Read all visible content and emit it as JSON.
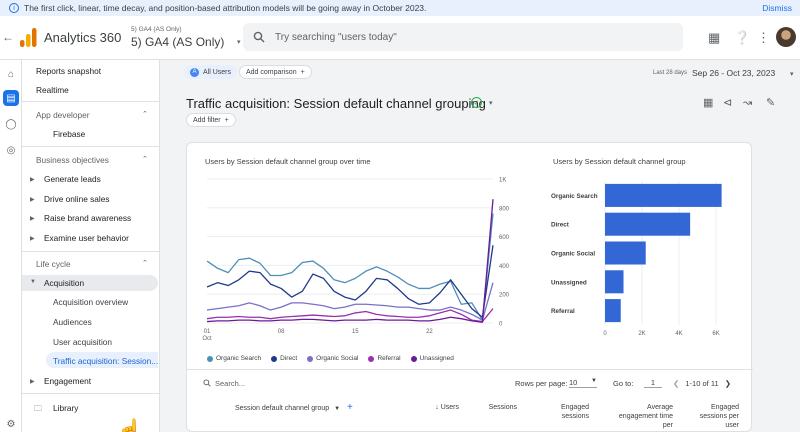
{
  "banner": {
    "message": "The first click, linear, time decay, and position-based attribution models will be going away in October 2023.",
    "dismiss": "Dismiss"
  },
  "header": {
    "app_name": "Analytics 360",
    "account_small": "5) GA4 (AS Only)",
    "account_big": "5) GA4 (AS Only)",
    "search_placeholder": "Try searching \"users today\""
  },
  "nav": {
    "reports_snapshot": "Reports snapshot",
    "realtime": "Realtime",
    "app_developer": "App developer",
    "firebase": "Firebase",
    "business_objectives": "Business objectives",
    "generate_leads": "Generate leads",
    "drive_online_sales": "Drive online sales",
    "raise_brand_awareness": "Raise brand awareness",
    "examine_user_behavior": "Examine user behavior",
    "life_cycle": "Life cycle",
    "acquisition": "Acquisition",
    "acquisition_overview": "Acquisition overview",
    "audiences": "Audiences",
    "user_acquisition": "User acquisition",
    "traffic_acquisition": "Traffic acquisition: Session...",
    "engagement": "Engagement",
    "library": "Library"
  },
  "toolbar": {
    "comparison_chip": "All Users",
    "comparison_chip_letter": "A",
    "add_comparison": "Add comparison",
    "date_label": "Last 28 days",
    "date_range": "Sep 26 - Oct 23, 2023",
    "page_title": "Traffic acquisition: Session default channel grouping",
    "add_filter": "Add filter"
  },
  "line_chart_title": "Users by Session default channel group over time",
  "bar_chart_title": "Users by Session default channel group",
  "chart_data": [
    {
      "type": "line",
      "title": "Users by Session default channel group over time",
      "x_ticks": [
        "01 Oct",
        "08",
        "15",
        "22"
      ],
      "yticks": [
        "0",
        "200",
        "400",
        "600",
        "800",
        "1K"
      ],
      "ylim": [
        0,
        1000
      ],
      "x": [
        1,
        2,
        3,
        4,
        5,
        6,
        7,
        8,
        9,
        10,
        11,
        12,
        13,
        14,
        15,
        16,
        17,
        18,
        19,
        20,
        21,
        22,
        23,
        24,
        25,
        26,
        27,
        28
      ],
      "series": [
        {
          "name": "Organic Search",
          "color": "#4e8fb8",
          "values": [
            430,
            380,
            350,
            440,
            450,
            415,
            330,
            330,
            350,
            420,
            430,
            380,
            300,
            280,
            310,
            360,
            390,
            360,
            320,
            270,
            240,
            240,
            270,
            290,
            130,
            140,
            20,
            760
          ]
        },
        {
          "name": "Direct",
          "color": "#1e3a8a",
          "values": [
            250,
            280,
            260,
            300,
            360,
            350,
            270,
            240,
            180,
            220,
            340,
            310,
            220,
            180,
            160,
            220,
            310,
            300,
            240,
            170,
            130,
            140,
            210,
            300,
            200,
            100,
            40,
            540
          ]
        },
        {
          "name": "Organic Social",
          "color": "#7a6fc9",
          "values": [
            90,
            100,
            110,
            120,
            140,
            120,
            90,
            110,
            140,
            140,
            130,
            120,
            100,
            110,
            130,
            130,
            125,
            120,
            110,
            110,
            100,
            90,
            90,
            110,
            90,
            60,
            20,
            280
          ]
        },
        {
          "name": "Referral",
          "color": "#9b2fae",
          "values": [
            30,
            40,
            40,
            45,
            40,
            40,
            30,
            40,
            45,
            50,
            55,
            50,
            45,
            50,
            70,
            80,
            60,
            50,
            45,
            40,
            40,
            50,
            70,
            90,
            60,
            20,
            10,
            100
          ]
        },
        {
          "name": "Unassigned",
          "color": "#6a1b9a",
          "values": [
            10,
            15,
            15,
            20,
            20,
            15,
            15,
            20,
            20,
            25,
            25,
            20,
            15,
            20,
            20,
            20,
            25,
            20,
            20,
            20,
            15,
            15,
            25,
            40,
            30,
            15,
            5,
            860
          ]
        }
      ]
    },
    {
      "type": "bar",
      "title": "Users by Session default channel group",
      "orientation": "horizontal",
      "categories": [
        "Organic Search",
        "Direct",
        "Organic Social",
        "Unassigned",
        "Referral"
      ],
      "values": [
        6300,
        4600,
        2200,
        1000,
        850
      ],
      "xticks": [
        "0",
        "2K",
        "4K",
        "6K"
      ],
      "xlim": [
        0,
        6700
      ],
      "color": "#3367d6"
    }
  ],
  "table": {
    "search_placeholder": "Search...",
    "rows_per_page_label": "Rows per page:",
    "rows_per_page_value": "10",
    "goto_label": "Go to:",
    "goto_value": "1",
    "pagination": "1-10 of 11",
    "dimension_header": "Session default channel group",
    "col_users": "Users",
    "col_sessions": "Sessions",
    "col_engaged_sessions": "Engaged sessions",
    "col_avg_engagement": "Average engagement time per",
    "col_engaged_per_user": "Engaged sessions per user"
  }
}
